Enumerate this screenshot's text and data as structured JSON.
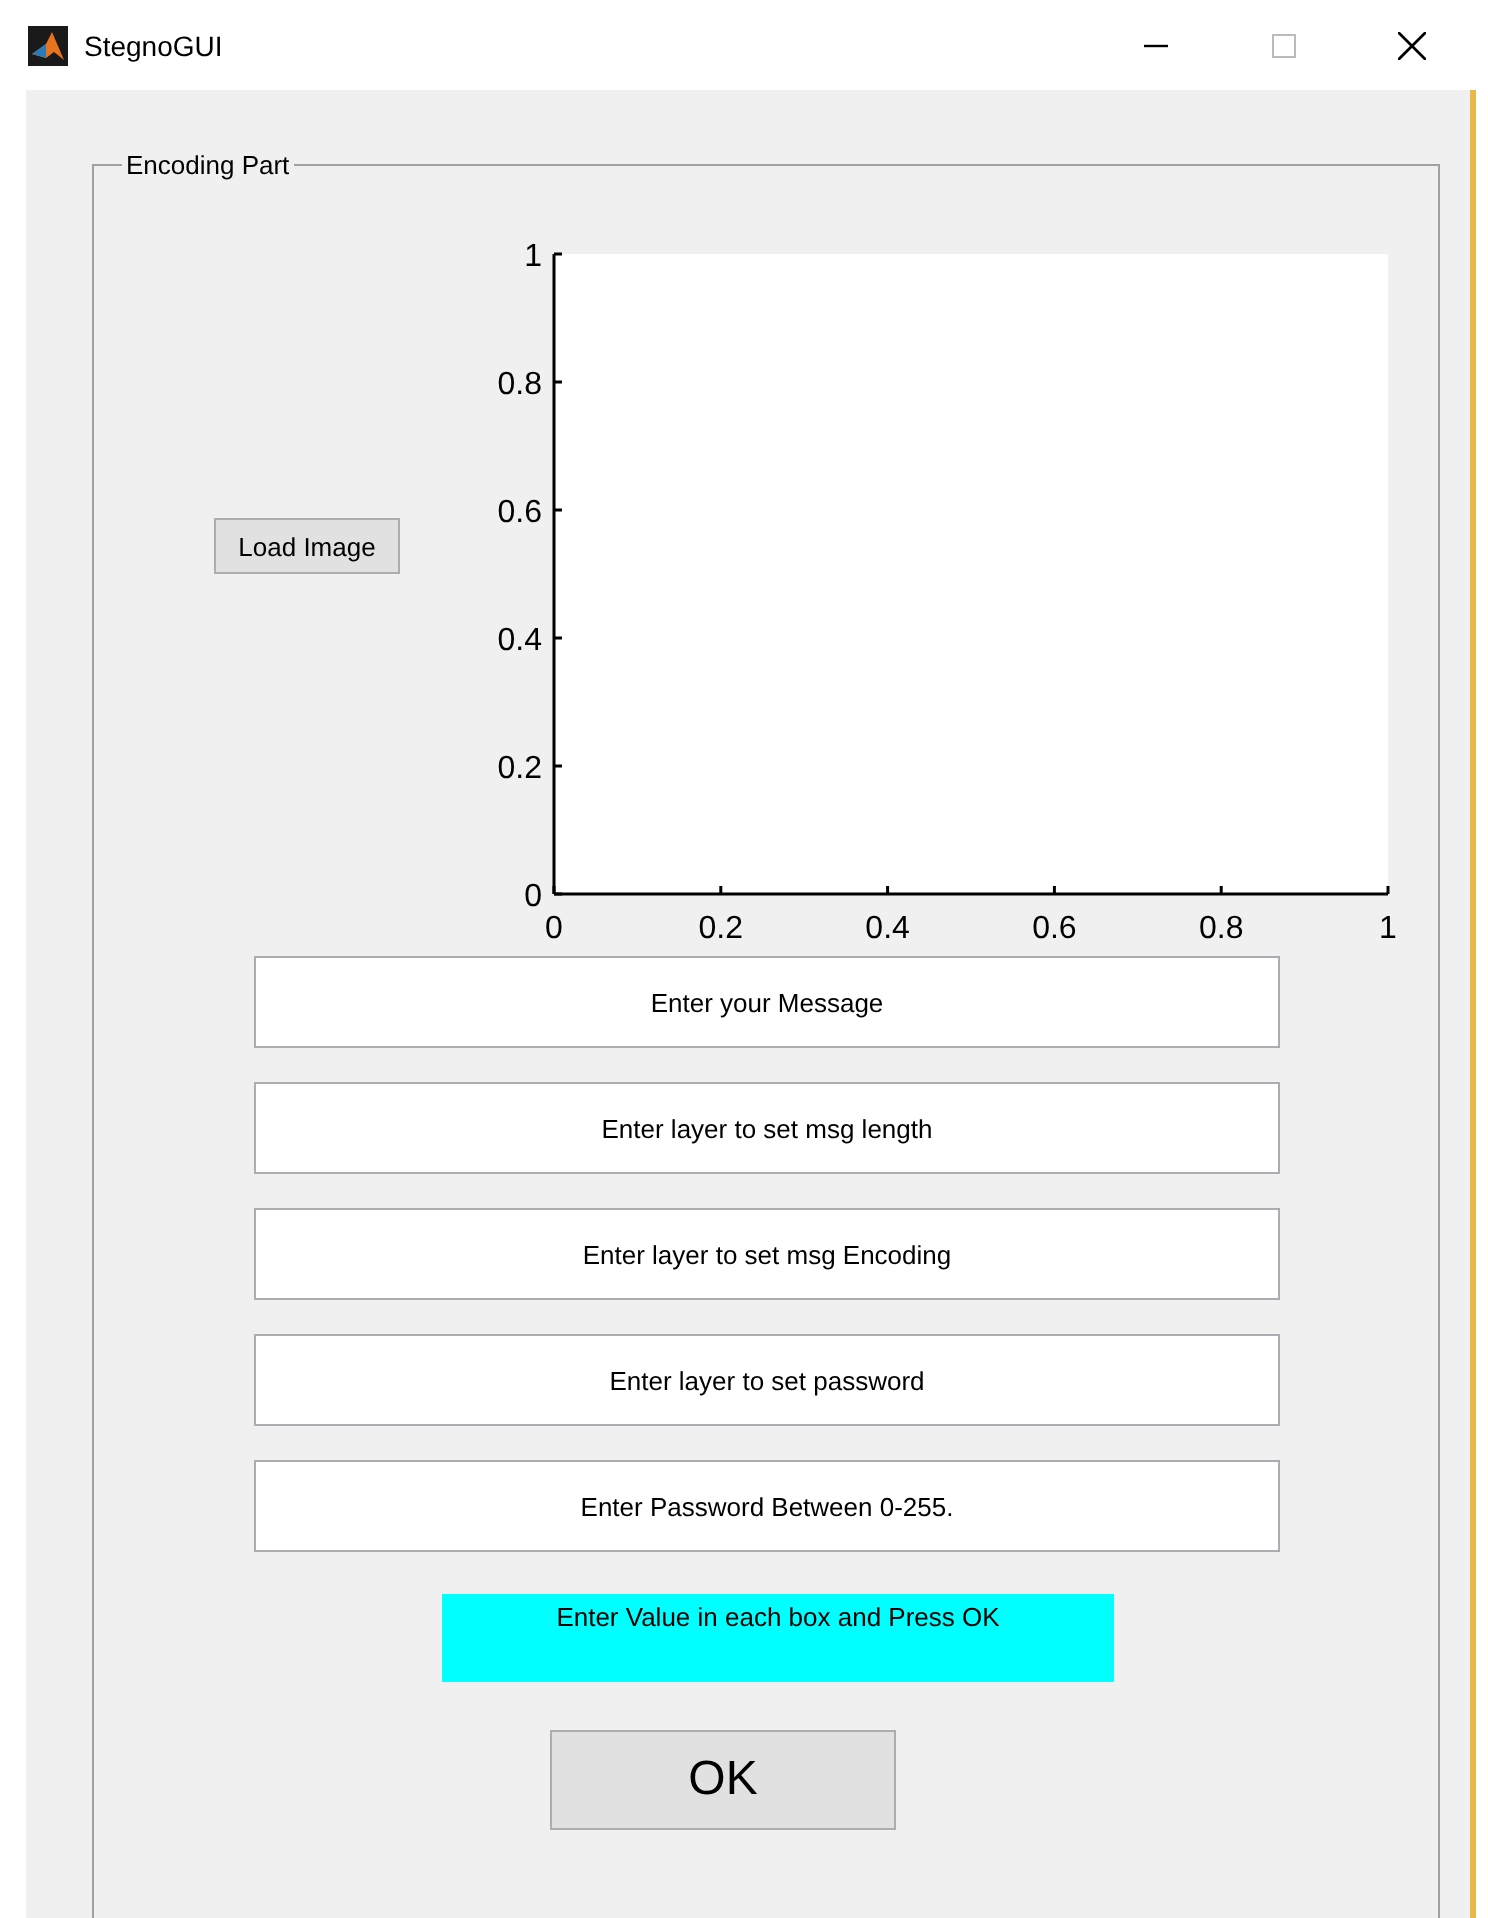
{
  "window": {
    "title": "StegnoGUI"
  },
  "panel": {
    "title": "Encoding Part",
    "load_button": "Load Image",
    "chart_data": {
      "type": "line",
      "xlim": [
        0,
        1
      ],
      "ylim": [
        0,
        1
      ],
      "xticks": [
        0,
        0.2,
        0.4,
        0.6,
        0.8,
        1
      ],
      "yticks": [
        0,
        0.2,
        0.4,
        0.6,
        0.8,
        1
      ]
    },
    "fields": [
      {
        "value": "Enter your Message"
      },
      {
        "value": "Enter layer to set msg length"
      },
      {
        "value": "Enter layer to set msg Encoding"
      },
      {
        "value": "Enter layer to set password"
      },
      {
        "value": "Enter Password Between 0-255."
      }
    ],
    "status": "Enter Value in each box and Press OK",
    "ok_button": "OK"
  }
}
